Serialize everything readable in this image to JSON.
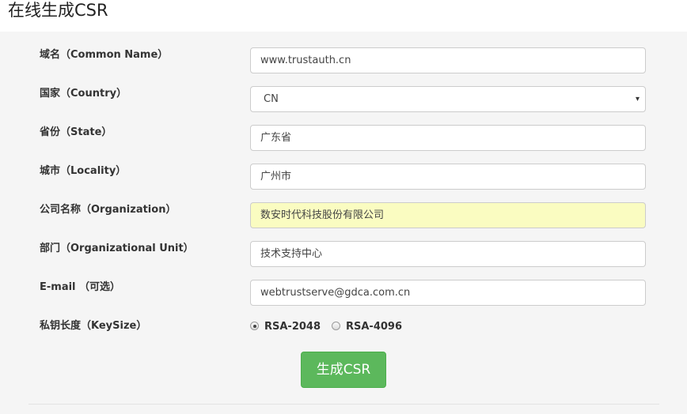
{
  "page": {
    "title": "在线生成CSR"
  },
  "form": {
    "common_name": {
      "label": "域名（Common Name）",
      "value": "www.trustauth.cn"
    },
    "country": {
      "label": "国家（Country）",
      "value": "CN",
      "caret": "▾"
    },
    "state": {
      "label": "省份（State）",
      "value": "广东省"
    },
    "locality": {
      "label": "城市（Locality）",
      "value": "广州市"
    },
    "organization": {
      "label": "公司名称（Organization）",
      "value": "数安时代科技股份有限公司"
    },
    "org_unit": {
      "label": "部门（Organizational Unit）",
      "value": "技术支持中心"
    },
    "email": {
      "label": "E-mail （可选）",
      "value": "webtrustserve@gdca.com.cn"
    },
    "key_size": {
      "label": "私钥长度（KeySize）",
      "options": [
        {
          "label": "RSA-2048",
          "checked": true
        },
        {
          "label": "RSA-4096",
          "checked": false
        }
      ]
    },
    "submit_label": "生成CSR"
  },
  "colors": {
    "submit_button": "#5cb85c",
    "autofill_highlight": "#fafcc1",
    "field_border": "#cccccc"
  }
}
